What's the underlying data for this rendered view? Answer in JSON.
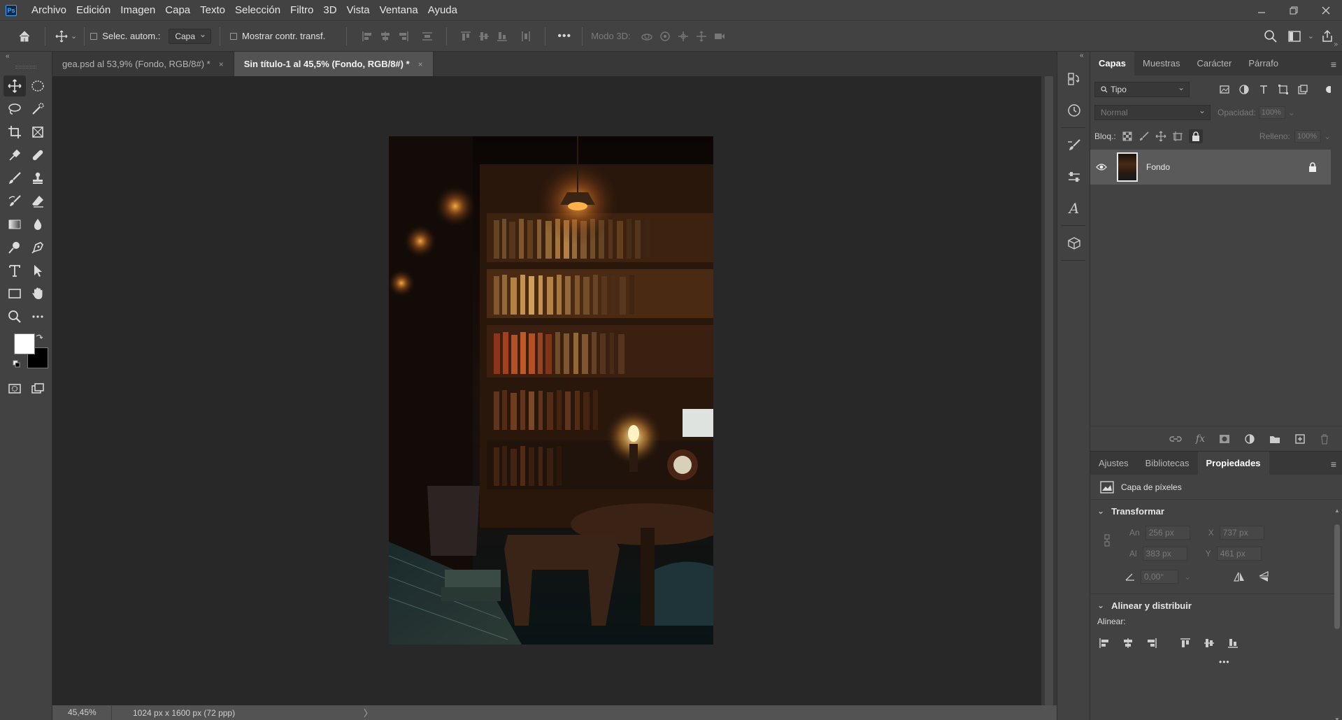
{
  "app": {
    "logo_text": "Ps"
  },
  "menu": [
    "Archivo",
    "Edición",
    "Imagen",
    "Capa",
    "Texto",
    "Selección",
    "Filtro",
    "3D",
    "Vista",
    "Ventana",
    "Ayuda"
  ],
  "options": {
    "auto_select_label": "Selec. autom.:",
    "auto_select_value": "Capa",
    "show_transform_label": "Mostrar contr. transf.",
    "mode_3d_label": "Modo 3D:"
  },
  "tabs": [
    {
      "label": "gea.psd al 53,9% (Fondo, RGB/8#) *",
      "close": "×"
    },
    {
      "label": "Sin título-1 al 45,5% (Fondo, RGB/8#) *",
      "close": "×"
    }
  ],
  "status": {
    "zoom": "45,45%",
    "doc_size": "1024 px x 1600 px (72 ppp)",
    "arrow": "〉"
  },
  "colors": {
    "foreground": "#ffffff",
    "background": "#000000",
    "accent": "#31a8ff"
  },
  "layers_panel": {
    "tabs": [
      "Capas",
      "Muestras",
      "Carácter",
      "Párrafo"
    ],
    "filter_value": "Tipo",
    "blend_mode": "Normal",
    "opacity_label": "Opacidad:",
    "opacity_value": "100%",
    "lock_label": "Bloq.:",
    "fill_label": "Relleno:",
    "fill_value": "100%",
    "layers": [
      {
        "name": "Fondo",
        "visible": true,
        "locked": true
      }
    ]
  },
  "props_panel": {
    "tabs": [
      "Ajustes",
      "Bibliotecas",
      "Propiedades"
    ],
    "layer_type": "Capa de píxeles",
    "transform_title": "Transformar",
    "w_label": "An",
    "w_value": "256 px",
    "h_label": "Al",
    "h_value": "383 px",
    "x_label": "X",
    "x_value": "737 px",
    "y_label": "Y",
    "y_value": "461 px",
    "angle_value": "0,00°",
    "align_title": "Alinear y distribuir",
    "align_label": "Alinear:",
    "more": "•••"
  }
}
